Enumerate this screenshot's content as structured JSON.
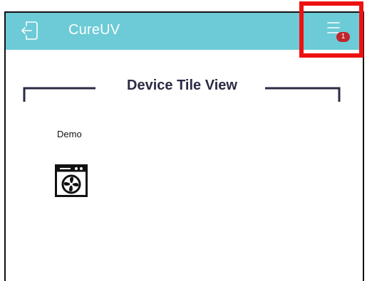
{
  "app": {
    "title": "CureUV",
    "header_color": "#6ccbd6",
    "icons": {
      "logout": "logout-icon",
      "menu": "hamburger-menu-icon"
    },
    "menu_badge_count": "1",
    "badge_color": "#c0272d",
    "highlight_color": "#ee1111"
  },
  "section": {
    "title": "Device Tile View"
  },
  "devices": [
    {
      "name": "Demo",
      "icon": "fan-device-icon"
    }
  ]
}
